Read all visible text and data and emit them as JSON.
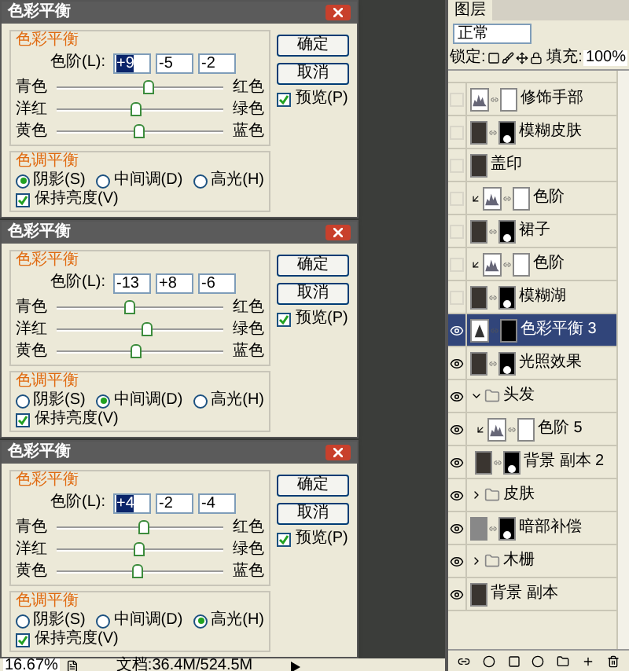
{
  "dialogs": [
    {
      "title": "色彩平衡",
      "group_balance": "色彩平衡",
      "levels_label": "色阶(L):",
      "values": [
        {
          "text": "+9",
          "highlighted": true
        },
        {
          "text": "-5",
          "highlighted": false
        },
        {
          "text": "-2",
          "highlighted": false
        }
      ],
      "sliders": [
        {
          "left": "青色",
          "right": "红色",
          "level": 0.55
        },
        {
          "left": "洋红",
          "right": "绿色",
          "level": 0.47
        },
        {
          "left": "黄色",
          "right": "蓝色",
          "level": 0.49
        }
      ],
      "ok": "确定",
      "cancel": "取消",
      "preview": {
        "label": "预览(P)",
        "checked": true
      },
      "group_tone": "色调平衡",
      "tones": [
        {
          "label": "阴影(S)",
          "selected": true
        },
        {
          "label": "中间调(D)",
          "selected": false
        },
        {
          "label": "高光(H)",
          "selected": false
        }
      ],
      "preserve": {
        "label": "保持亮度(V)",
        "checked": true
      }
    },
    {
      "title": "色彩平衡",
      "group_balance": "色彩平衡",
      "levels_label": "色阶(L):",
      "values": [
        {
          "text": "-13",
          "highlighted": false
        },
        {
          "text": "+8",
          "highlighted": false
        },
        {
          "text": "-6",
          "highlighted": false
        }
      ],
      "sliders": [
        {
          "left": "青色",
          "right": "红色",
          "level": 0.43
        },
        {
          "left": "洋红",
          "right": "绿色",
          "level": 0.54
        },
        {
          "left": "黄色",
          "right": "蓝色",
          "level": 0.47
        }
      ],
      "ok": "确定",
      "cancel": "取消",
      "preview": {
        "label": "预览(P)",
        "checked": true
      },
      "group_tone": "色调平衡",
      "tones": [
        {
          "label": "阴影(S)",
          "selected": false
        },
        {
          "label": "中间调(D)",
          "selected": true
        },
        {
          "label": "高光(H)",
          "selected": false
        }
      ],
      "preserve": {
        "label": "保持亮度(V)",
        "checked": true
      }
    },
    {
      "title": "色彩平衡",
      "group_balance": "色彩平衡",
      "levels_label": "色阶(L):",
      "values": [
        {
          "text": "+4",
          "highlighted": true
        },
        {
          "text": "-2",
          "highlighted": false
        },
        {
          "text": "-4",
          "highlighted": false
        }
      ],
      "sliders": [
        {
          "left": "青色",
          "right": "红色",
          "level": 0.52
        },
        {
          "left": "洋红",
          "right": "绿色",
          "level": 0.49
        },
        {
          "left": "黄色",
          "right": "蓝色",
          "level": 0.48
        }
      ],
      "ok": "确定",
      "cancel": "取消",
      "preview": {
        "label": "预览(P)",
        "checked": true
      },
      "group_tone": "色调平衡",
      "tones": [
        {
          "label": "阴影(S)",
          "selected": false
        },
        {
          "label": "中间调(D)",
          "selected": false
        },
        {
          "label": "高光(H)",
          "selected": true
        }
      ],
      "preserve": {
        "label": "保持亮度(V)",
        "checked": true
      }
    }
  ],
  "status_bar": {
    "zoom": "16.67%",
    "doc": "文档:36.4M/524.5M"
  },
  "layers_panel": {
    "tabs": [
      {
        "label": "图层",
        "selected": true
      }
    ],
    "blend_mode": "正常",
    "lock_label": "锁定:",
    "fill_label": "填充:",
    "fill": "100%",
    "layers": [
      {
        "kind": "levels",
        "name": "修饰手部",
        "visible": false,
        "clipped": false,
        "selected": false
      },
      {
        "kind": "photo",
        "name": "模糊皮肤",
        "visible": false,
        "clipped": false,
        "selected": false
      },
      {
        "kind": "photo-only",
        "name": "盖印",
        "visible": false,
        "clipped": false,
        "selected": false
      },
      {
        "kind": "levels",
        "name": "色阶",
        "visible": false,
        "clipped": true,
        "selected": false
      },
      {
        "kind": "photo",
        "name": "裙子",
        "visible": false,
        "clipped": false,
        "selected": false
      },
      {
        "kind": "levels",
        "name": "色阶",
        "visible": false,
        "clipped": true,
        "selected": false
      },
      {
        "kind": "photo",
        "name": "模糊湖",
        "visible": false,
        "clipped": false,
        "selected": false
      },
      {
        "kind": "balance",
        "name": "色彩平衡 3",
        "visible": true,
        "clipped": false,
        "selected": true
      },
      {
        "kind": "photo",
        "name": "光照效果",
        "visible": true,
        "clipped": false,
        "selected": false
      },
      {
        "kind": "group",
        "name": "头发",
        "visible": true,
        "expanded": true,
        "selected": false,
        "children": [
          {
            "kind": "levels",
            "name": "色阶 5",
            "visible": true,
            "clipped": true,
            "selected": false
          },
          {
            "kind": "photo",
            "name": "背景 副本 2",
            "visible": true,
            "clipped": false,
            "selected": false
          }
        ]
      },
      {
        "kind": "group",
        "name": "皮肤",
        "visible": true,
        "expanded": false,
        "selected": false
      },
      {
        "kind": "fill",
        "name": "暗部补偿",
        "visible": true,
        "clipped": false,
        "selected": false
      },
      {
        "kind": "group",
        "name": "木栅",
        "visible": true,
        "expanded": false,
        "selected": false
      },
      {
        "kind": "photo-only",
        "name": "背景 副本",
        "visible": true,
        "clipped": false,
        "selected": false
      }
    ]
  }
}
